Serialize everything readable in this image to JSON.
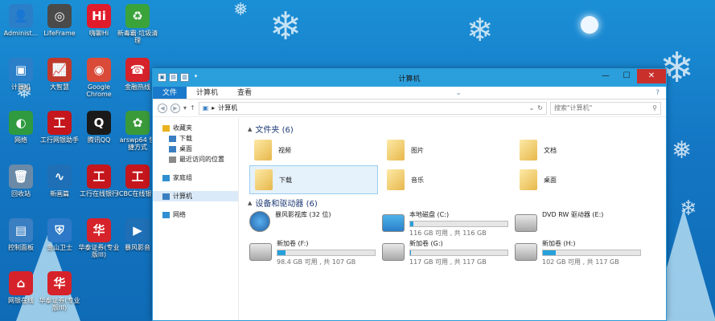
{
  "desktop_icons": [
    {
      "label": "Administ...",
      "icon": "user-icon",
      "color": "#2a7fc8"
    },
    {
      "label": "LifeFrame",
      "icon": "camera-icon",
      "color": "#4a4a4a"
    },
    {
      "label": "嗨聊Hi",
      "icon": "hi-icon",
      "color": "#e01b2b"
    },
    {
      "label": "新毒霸·垃圾清理",
      "icon": "recycle-clean-icon",
      "color": "#3aa33a"
    },
    {
      "label": "计算机",
      "icon": "computer-icon",
      "color": "#2a7fc8"
    },
    {
      "label": "大智慧",
      "icon": "chart-icon",
      "color": "#c0392b"
    },
    {
      "label": "Google Chrome",
      "icon": "chrome-icon",
      "color": "#d94a38"
    },
    {
      "label": "金融热线",
      "icon": "hotline-icon",
      "color": "#d6222a"
    },
    {
      "label": "网络",
      "icon": "globe-icon",
      "color": "#2f9a3f"
    },
    {
      "label": "工行网银助手",
      "icon": "icbc-icon",
      "color": "#c4161c"
    },
    {
      "label": "腾讯QQ",
      "icon": "qq-icon",
      "color": "#1a1a1a"
    },
    {
      "label": "arswp64 快捷方式",
      "icon": "shortcut-icon",
      "color": "#3a9a3a"
    },
    {
      "label": "回收站",
      "icon": "recycle-bin-icon",
      "color": "#6a8aa8"
    },
    {
      "label": "新画篇",
      "icon": "swirl-icon",
      "color": "#1f6fb6"
    },
    {
      "label": "工行在线银行",
      "icon": "icbc-online-icon",
      "color": "#c4161c"
    },
    {
      "label": "ICBC在线银行",
      "icon": "icbc-bank-icon",
      "color": "#c4161c"
    },
    {
      "label": "控制面板",
      "icon": "control-panel-icon",
      "color": "#3a7fc2"
    },
    {
      "label": "金山卫士",
      "icon": "shield-icon",
      "color": "#2d79c7"
    },
    {
      "label": "华泰证券(专业版III)",
      "icon": "htsc-icon",
      "color": "#d6222a"
    },
    {
      "label": "暴风影音",
      "icon": "media-player-icon",
      "color": "#1f6fb6"
    },
    {
      "label": "网银在线",
      "icon": "home-icon",
      "color": "#d6222a"
    },
    {
      "label": "华泰证券(专业版III)",
      "icon": "htsc-pro-icon",
      "color": "#d6222a"
    }
  ],
  "window": {
    "title": "计算机",
    "qat": [
      "▣",
      "▤",
      "▥",
      "▾"
    ],
    "minimize": "—",
    "maximize": "☐",
    "close": "✕"
  },
  "ribbon": {
    "tabs": [
      "文件",
      "计算机",
      "查看"
    ],
    "expand": "⌄",
    "help": "?"
  },
  "address": {
    "path_root": "▸",
    "path": "计算机",
    "search_placeholder": "搜索\"计算机\""
  },
  "nav_pane": {
    "items": [
      {
        "label": "收藏夹",
        "icon": "star-icon",
        "indent": 0
      },
      {
        "label": "下载",
        "icon": "download-folder-icon",
        "indent": 1
      },
      {
        "label": "桌面",
        "icon": "desktop-folder-icon",
        "indent": 1
      },
      {
        "label": "最近访问的位置",
        "icon": "recent-places-icon",
        "indent": 1
      },
      {
        "label": "家庭组",
        "icon": "homegroup-icon",
        "indent": 0
      },
      {
        "label": "计算机",
        "icon": "computer-icon",
        "indent": 0,
        "selected": true
      },
      {
        "label": "网络",
        "icon": "network-icon",
        "indent": 0
      }
    ]
  },
  "content": {
    "folders_header": "文件夹 (6)",
    "folders": [
      {
        "label": "视频",
        "icon": "videos-folder-icon"
      },
      {
        "label": "图片",
        "icon": "pictures-folder-icon"
      },
      {
        "label": "文档",
        "icon": "documents-folder-icon"
      },
      {
        "label": "下载",
        "icon": "downloads-folder-icon",
        "selected": true
      },
      {
        "label": "音乐",
        "icon": "music-folder-icon"
      },
      {
        "label": "桌面",
        "icon": "desktop-folder-icon"
      }
    ],
    "drives_header": "设备和驱动器 (6)",
    "drives": [
      {
        "label": "暴风影视库 (32 位)",
        "icon": "baofeng-icon",
        "free": "",
        "used_fraction": null
      },
      {
        "label": "本地磁盘 (C:)",
        "icon": "windows-drive-icon",
        "free": "116 GB 可用 , 共 116 GB",
        "used_fraction": 0.03
      },
      {
        "label": "DVD RW 驱动器 (E:)",
        "icon": "dvd-drive-icon",
        "free": "",
        "used_fraction": null
      },
      {
        "label": "新加卷 (F:)",
        "icon": "hard-drive-icon",
        "free": "98.4 GB 可用 , 共 107 GB",
        "used_fraction": 0.08
      },
      {
        "label": "新加卷 (G:)",
        "icon": "hard-drive-icon",
        "free": "117 GB 可用 , 共 117 GB",
        "used_fraction": 0.01
      },
      {
        "label": "新加卷 (H:)",
        "icon": "hard-drive-icon",
        "free": "102 GB 可用 , 共 117 GB",
        "used_fraction": 0.13
      }
    ]
  }
}
